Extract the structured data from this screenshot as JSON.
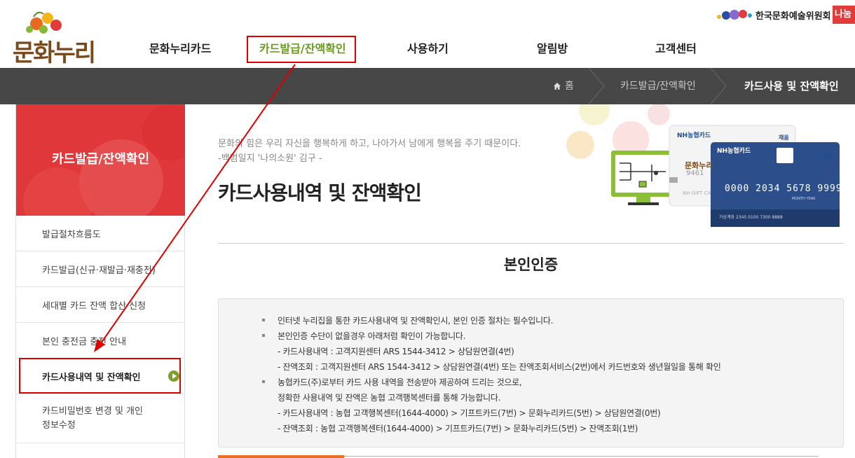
{
  "header": {
    "logo_text": "문화누리",
    "nav": [
      "문화누리카드",
      "카드발급/잔액확인",
      "사용하기",
      "알림방",
      "고객센터"
    ],
    "arts_council": "한국문화예술위원회",
    "nanum": "나눔"
  },
  "breadcrumb": {
    "home": "홈",
    "level1": "카드발급/잔액확인",
    "current": "카드사용 및 잔액확인"
  },
  "sidebar": {
    "title": "카드발급/잔액확인",
    "items": [
      "발급절차흐름도",
      "카드발급(신규·재발급·재충전)",
      "세대별 카드 잔액 합산 신청",
      "본인 충전금 충전 안내",
      "카드사용내역 및 잔액확인",
      "카드비밀번호 변경 및 개인",
      "정보수정"
    ]
  },
  "content": {
    "quote_line1": "문화의 힘은 우리 자신을 행복하게 하고, 나아가서 남에게 행복을 주기 때문이다.",
    "quote_line2": "-백범일지 '나의소원' 김구 -",
    "page_title": "카드사용내역 및 잔액확인",
    "section_title": "본인인증",
    "lines": [
      "인터넷 누리집을 통한 카드사용내역 및 잔액확인시, 본인 인증 절차는 필수입니다.",
      "본인인증 수단이 없을경우 아래처럼 확인이 가능합니다.",
      "- 카드사용내역 : 고객지원센터 ARS 1544-3412 > 상담원연결(4번)",
      "- 잔액조회 : 고객지원센터 ARS 1544-3412 > 상담원연결(4번) 또는 잔액조회서비스(2번)에서 카드번호와 생년월일을 통해 확인",
      "농협카드(주)로부터 카드 사용 내역을 전송받아 제공하여 드리는 것으로,",
      "정확한 사용내역 및 잔액은 농협 고객행복센터를 통해 가능합니다.",
      "- 카드사용내역 : 농협 고객행복센터(1644-4000) > 기프트카드(7번) > 문화누리카드(5번) > 상담원연결(0번)",
      "- 잔액조회 : 농협 고객행복센터(1644-4000) > 기프트카드(7번) > 문화누리카드(5번) > 잔액조회(1번)"
    ],
    "card_front": {
      "brand": "NH농협카드",
      "number": "0000 2034 5678 9999",
      "chip_label": "채움",
      "footer": "가상계좌 2345 0100 7300 8888",
      "month_year": "MONTH YEAR"
    },
    "card_back": {
      "brand": "NH농협카드",
      "logo": "문화누리",
      "number": "9461",
      "footer": "NH GIFT CA",
      "chip_label": "채움"
    }
  },
  "colors": {
    "accent_green": "#6a9a1e",
    "sidebar_red": "#e0373a",
    "crumb_bar": "#474747",
    "annotation_red": "#e10000"
  }
}
